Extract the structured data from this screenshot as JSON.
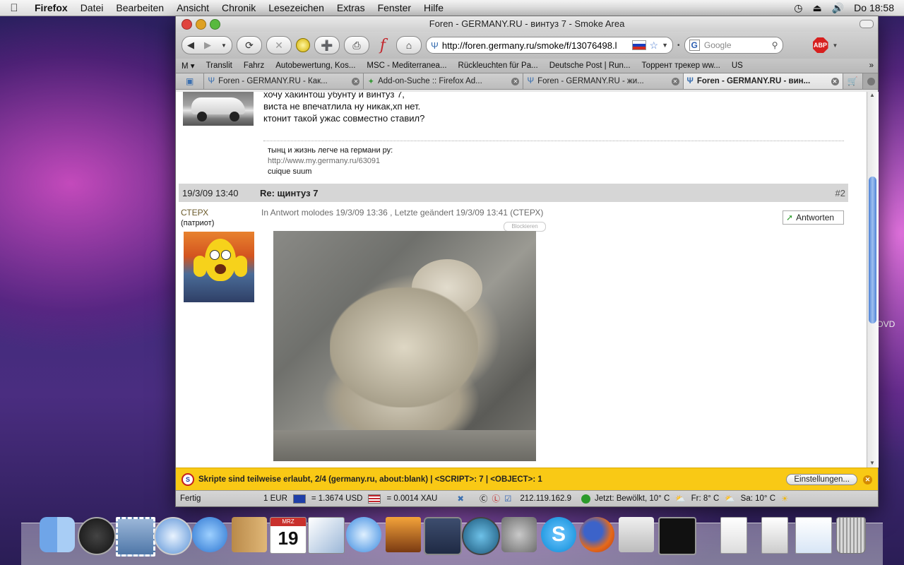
{
  "menubar": {
    "app": "Firefox",
    "items": [
      "Datei",
      "Bearbeiten",
      "Ansicht",
      "Chronik",
      "Lesezeichen",
      "Extras",
      "Fenster",
      "Hilfe"
    ],
    "clock": "Do 18:58"
  },
  "window": {
    "title": "Foren - GERMANY.RU - винтуз 7 - Smoke Area"
  },
  "toolbar": {
    "url": "http://foren.germany.ru/smoke/f/13076498.l",
    "search_placeholder": "Google",
    "abp_label": "ABP"
  },
  "bookmarks": [
    "M ▾",
    "Translit",
    "Fahrz",
    "Autobewertung, Kos...",
    "MSC - Mediterranea...",
    "Rückleuchten für Pa...",
    "Deutsche Post | Run...",
    "Торрент трекер ww...",
    "US"
  ],
  "tabs": [
    {
      "label": "Foren - GERMANY.RU - Как..."
    },
    {
      "label": "Add-on-Suche :: Firefox Ad..."
    },
    {
      "label": "Foren - GERMANY.RU - жи..."
    },
    {
      "label": "Foren - GERMANY.RU - вин..."
    }
  ],
  "post1": {
    "lines": [
      "хочу хакинтош убунту и винтуз 7,",
      "виста не впечатлила ну никак,хп нет.",
      "ктонит такой ужас совместно ставил?"
    ],
    "signature": [
      "тынц и жизнь легче на германи ру:",
      "http://www.my.germany.ru/63091",
      "cuique suum"
    ]
  },
  "post2": {
    "date": "19/3/09 13:40",
    "title": "Re: щинтуз 7",
    "number": "#2",
    "author": "СТЕРХ",
    "rank": "(патриот)",
    "meta": "In Antwort molodes 19/3/09 13:36 , Letzte geändert 19/3/09 13:41 (СТЕРХ)",
    "reply_label": "Antworten",
    "block_label": "Blockieren"
  },
  "notification": {
    "text": "Skripte sind teilweise erlaubt, 2/4 (germany.ru, about:blank) | <SCRIPT>: 7 | <OBJECT>: 1",
    "button": "Einstellungen..."
  },
  "statusbar": {
    "status": "Fertig",
    "eur": "1 EUR",
    "usd": "= 1.3674 USD",
    "xau": "= 0.0014 XAU",
    "ip": "212.119.162.9",
    "weather_now": "Jetzt: Bewölkt, 10° C",
    "fr": "Fr: 8° C",
    "sa": "Sa: 10° C"
  },
  "desktop": {
    "edge_label": "DVD"
  },
  "dock": {
    "calendar_month": "MRZ",
    "calendar_day": "19"
  },
  "colors": {
    "notify_bar": "#f9c915",
    "link_gray": "#6b6b6b",
    "author_olive": "#6b5a2b",
    "scroll_thumb": "#4e82d6"
  }
}
